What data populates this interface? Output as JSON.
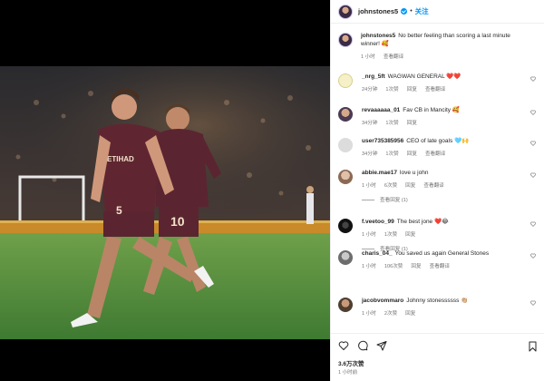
{
  "post": {
    "username": "johnstones5",
    "follow_label": "关注",
    "separator": "•",
    "likes": "3.6万次赞",
    "time": "1 小时前"
  },
  "caption": {
    "username": "johnstones5",
    "text": "No better feeling than scoring a last minute winner! 🥰",
    "time": "1 小时",
    "translate": "查看翻译"
  },
  "comments": [
    {
      "username": "_nrg_5ft",
      "text": "WAGWAN GENERAL ❤️❤️",
      "time": "24分钟",
      "likes": "1次赞",
      "reply": "回复",
      "translate": "查看翻译",
      "avatar_color": "#f5f0c8"
    },
    {
      "username": "revaaaaaa_01",
      "text": "Fav CB in Mancity 🥰",
      "time": "34分钟",
      "likes": "1次赞",
      "reply": "回复",
      "avatar_color": "#6b5a70"
    },
    {
      "username": "user735385956",
      "text": "CEO of late goals 🩵🙌",
      "time": "34分钟",
      "likes": "1次赞",
      "reply": "回复",
      "translate": "查看翻译",
      "avatar_color": "#d9d9d9"
    },
    {
      "username": "abbie.mae17",
      "text": "love u john",
      "time": "1 小时",
      "likes": "6次赞",
      "reply": "回复",
      "translate": "查看翻译",
      "replies_label": "查看回复 (1)",
      "avatar_color": "#b7a090"
    },
    {
      "username": "f.veetoo_99",
      "text": "The best jone ❤️😂",
      "time": "1 小时",
      "likes": "1次赞",
      "reply": "回复",
      "replies_label": "查看回复 (1)",
      "avatar_color": "#222222"
    },
    {
      "username": "charis_04_",
      "text": "You saved us again General Stones",
      "time": "1 小时",
      "likes": "106次赞",
      "reply": "回复",
      "translate": "查看翻译",
      "avatar_color": "#8a8a8a"
    },
    {
      "username": "jacobvommaro",
      "text": "Johnny stonessssss 👏🏼",
      "time": "1 小时",
      "likes": "2次赞",
      "reply": "回复",
      "avatar_color": "#5a4a3a"
    }
  ],
  "colors": {
    "link": "#0095f6",
    "heart": "#ed4956",
    "muted": "#737373",
    "kit": "#5a2530"
  },
  "icons": [
    "verified-badge-icon",
    "heart-icon",
    "comment-icon",
    "share-icon",
    "bookmark-icon"
  ]
}
